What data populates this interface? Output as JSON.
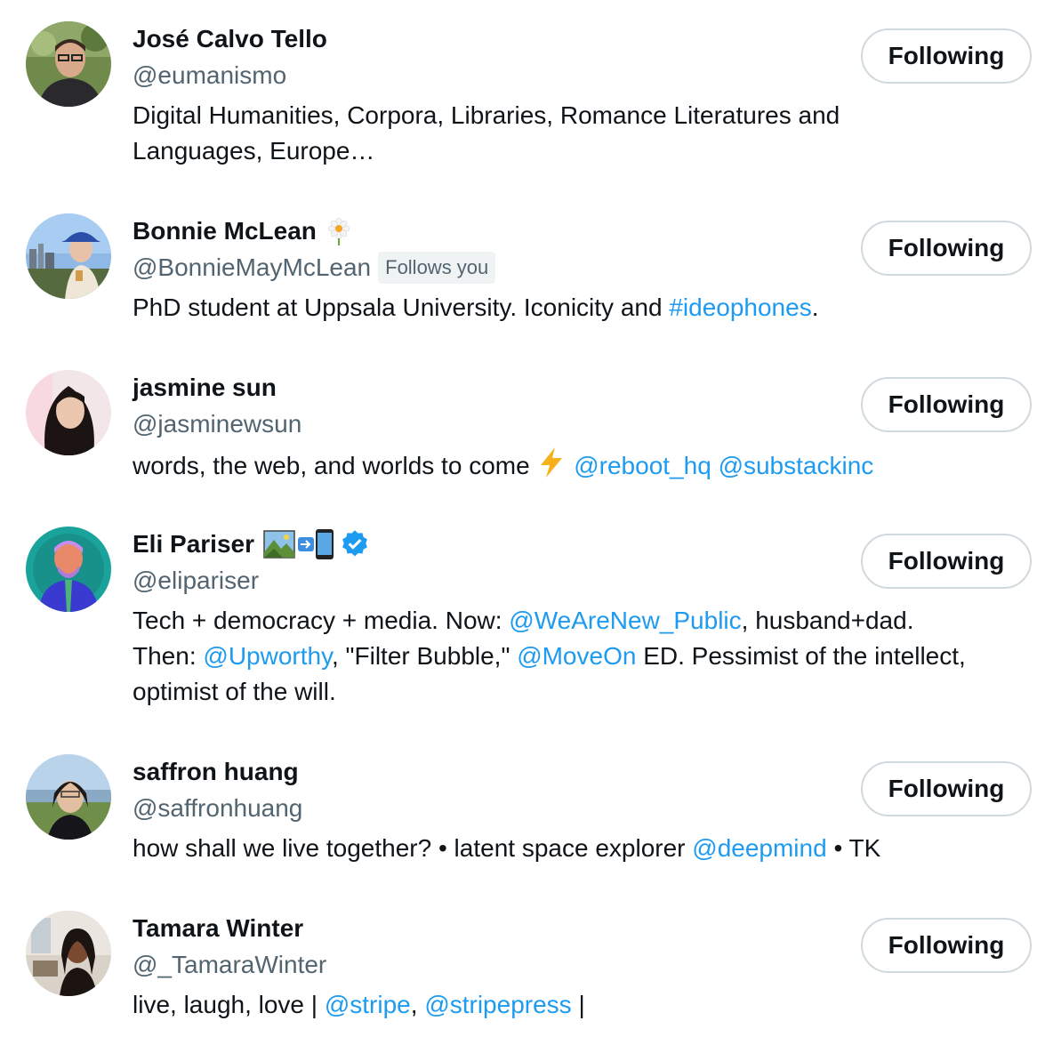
{
  "colors": {
    "link": "#1d9bf0",
    "muted": "#536471",
    "text": "#0f1419",
    "border": "#cfd9de"
  },
  "users": [
    {
      "name": "José Calvo Tello",
      "handle": "@eumanismo",
      "button": "Following",
      "bio_1": "Digital Humanities, Corpora, Libraries, Romance Literatures and",
      "bio_2": "Languages, Europe…"
    },
    {
      "name": "Bonnie McLean",
      "handle": "@BonnieMayMcLean",
      "follows_you": "Follows you",
      "button": "Following",
      "bio_1": "PhD student at Uppsala University. Iconicity and ",
      "bio_link_1": "#ideophones",
      "bio_2": "."
    },
    {
      "name": "jasmine sun",
      "handle": "@jasminewsun",
      "button": "Following",
      "bio_1": "words, the web, and worlds to come ",
      "bio_link_1": "@reboot_hq",
      "bio_link_2": "@substackinc"
    },
    {
      "name": "Eli Pariser",
      "handle": "@elipariser",
      "button": "Following",
      "bio_1": "Tech + democracy + media. Now: ",
      "bio_link_1": "@WeAreNew_Public",
      "bio_2": ", husband+dad.",
      "bio_3": "Then: ",
      "bio_link_2": "@Upworthy",
      "bio_4": ", \"Filter Bubble,\" ",
      "bio_link_3": "@MoveOn",
      "bio_5": " ED. Pessimist of the intellect,",
      "bio_6": "optimist of the will."
    },
    {
      "name": "saffron huang",
      "handle": "@saffronhuang",
      "button": "Following",
      "bio_1": "how shall we live together? • latent space explorer ",
      "bio_link_1": "@deepmind",
      "bio_2": " • TK"
    },
    {
      "name": "Tamara Winter",
      "handle": "@_TamaraWinter",
      "button": "Following",
      "bio_1": "live, laugh, love | ",
      "bio_link_1": "@stripe",
      "bio_2": ", ",
      "bio_link_2": "@stripepress",
      "bio_3": " |"
    }
  ]
}
